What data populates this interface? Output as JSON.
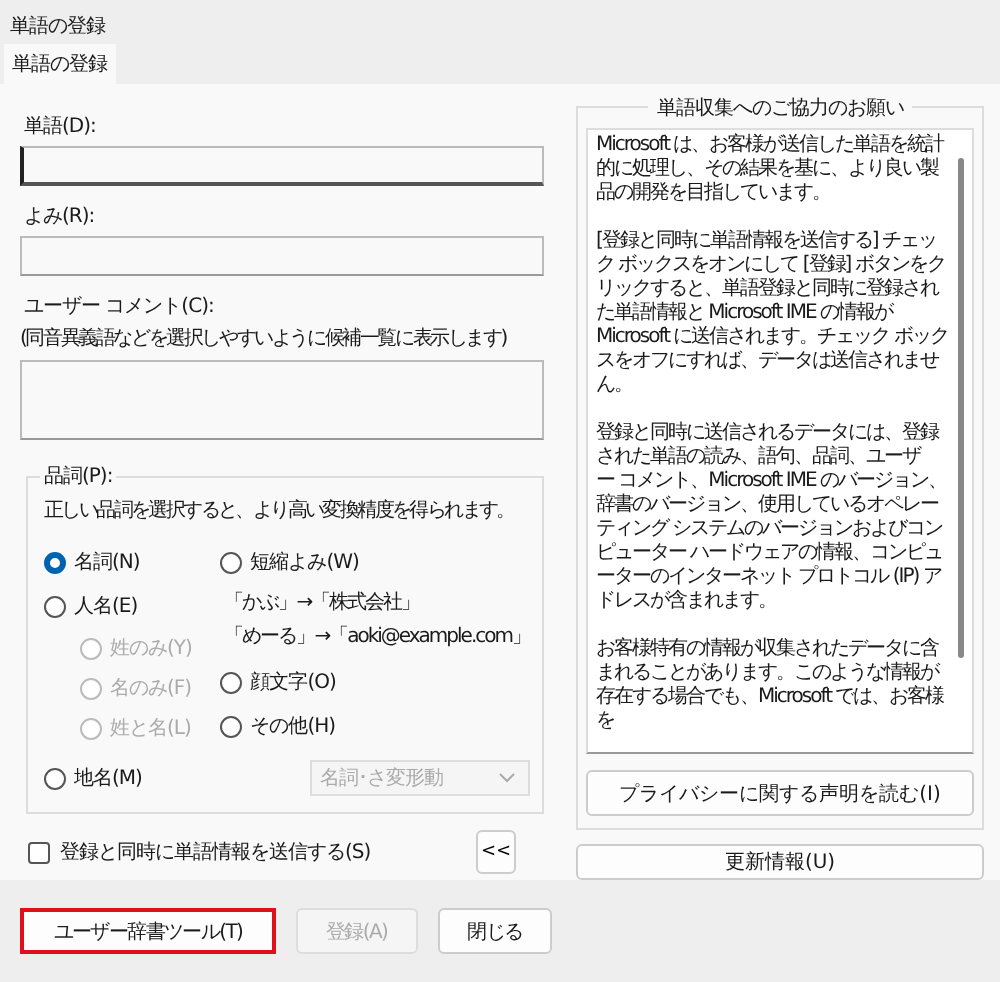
{
  "window": {
    "title": "単語の登録"
  },
  "tabs": [
    {
      "label": "単語の登録",
      "selected": true
    }
  ],
  "fields": [
    {
      "label": "単語(D):",
      "kind": "line",
      "focused": true
    },
    {
      "label": "よみ(R):",
      "kind": "line",
      "focused": false
    },
    {
      "label": "ユーザー コメント(C):",
      "hint": "(同音異義語などを選択しやすいように候補一覧に表示します)",
      "kind": "area",
      "focused": false
    }
  ],
  "part_of_speech": {
    "title": "品詞(P):",
    "hint": "正しい品詞を選択すると、より高い変換精度を得られます。",
    "left_options": [
      {
        "kind": "radio",
        "label": "名詞(N)",
        "selected": true,
        "disabled": false
      },
      {
        "kind": "radio",
        "label": "人名(E)",
        "selected": false,
        "disabled": false,
        "children": [
          {
            "kind": "radio",
            "label": "姓のみ(Y)",
            "selected": false,
            "disabled": true
          },
          {
            "kind": "radio",
            "label": "名のみ(F)",
            "selected": false,
            "disabled": true
          },
          {
            "kind": "radio",
            "label": "姓と名(L)",
            "selected": false,
            "disabled": true
          }
        ]
      }
    ],
    "right_options": [
      {
        "kind": "radio",
        "label": "短縮よみ(W)",
        "selected": false,
        "disabled": false
      },
      {
        "kind": "example",
        "label": "「かぶ」→「株式会社」"
      },
      {
        "kind": "example",
        "label": "「めーる」→「aoki@example.com」"
      },
      {
        "kind": "radio",
        "label": "顔文字(O)",
        "selected": false,
        "disabled": false
      },
      {
        "kind": "radio",
        "label": "その他(H)",
        "selected": false,
        "disabled": false
      }
    ],
    "place_option": {
      "kind": "radio",
      "label": "地名(M)",
      "selected": false,
      "disabled": false
    },
    "dropdown": {
      "value": "名詞･さ変形動",
      "disabled": true
    }
  },
  "send_checkbox": {
    "label": "登録と同時に単語情報を送信する(S)",
    "checked": false
  },
  "collapse_button": {
    "label": "<<"
  },
  "info_panel": {
    "title": "単語収集へのご協力のお願い",
    "paragraphs": [
      "Microsoft は、お客様が送信した単語を統計的に処理し、その結果を基に、より良い製品の開発を目指しています。",
      "[登録と同時に単語情報を送信する] チェック ボックスをオンにして [登録] ボタンをクリックすると、単語登録と同時に登録された単語情報と Microsoft IME の情報が Microsoft に送信されます。チェック ボックスをオフにすれば、データは送信されません。",
      "登録と同時に送信されるデータには、登録された単語の読み、語句、品詞、ユーザー コメント、Microsoft IME のバージョン、辞書のバージョン、使用しているオペレーティング システムのバージョンおよびコンピューター ハードウェアの情報、コンピューターのインターネット プロトコル (IP) アドレスが含まれます。",
      "お客様特有の情報が収集されたデータに含まれることがあります。このような情報が存在する場合でも、Microsoft では、お客様を"
    ],
    "privacy_button": {
      "label": "プライバシーに関する声明を読む(I)"
    }
  },
  "update_button": {
    "label": "更新情報(U)"
  },
  "buttons": [
    {
      "label": "ユーザー辞書ツール(T)",
      "disabled": false,
      "highlighted": true
    },
    {
      "label": "登録(A)",
      "disabled": true,
      "highlighted": false
    },
    {
      "label": "閉じる",
      "disabled": false,
      "highlighted": false
    }
  ]
}
